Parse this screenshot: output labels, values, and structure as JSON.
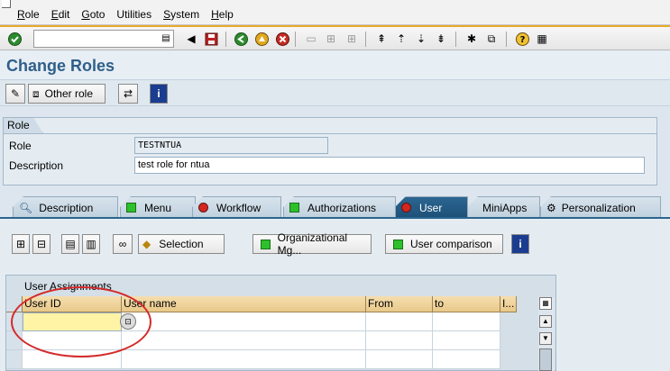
{
  "menu": {
    "items": [
      {
        "label": "Role",
        "mn": "R",
        "rest": "ole"
      },
      {
        "label": "Edit",
        "mn": "E",
        "rest": "dit"
      },
      {
        "label": "Goto",
        "mn": "G",
        "rest": "oto"
      },
      {
        "label": "Utilities",
        "mn": "",
        "rest": "Utilities"
      },
      {
        "label": "System",
        "mn": "S",
        "rest": "ystem"
      },
      {
        "label": "Help",
        "mn": "H",
        "rest": "elp"
      }
    ]
  },
  "toolbar": {
    "command_value": ""
  },
  "title": "Change Roles",
  "app_toolbar": {
    "other_role_label": "Other role"
  },
  "role_group": {
    "title": "Role",
    "role_label": "Role",
    "role_value": "TESTNTUA",
    "description_label": "Description",
    "description_value": "test role for ntua"
  },
  "tabs": [
    {
      "label": "Description"
    },
    {
      "label": "Menu"
    },
    {
      "label": "Workflow"
    },
    {
      "label": "Authorizations"
    },
    {
      "label": "User"
    },
    {
      "label": "MiniApps"
    },
    {
      "label": "Personalization"
    }
  ],
  "panel": {
    "selection_label": "Selection",
    "org_mgmt_label": "Organizational Mg...",
    "user_comparison_label": "User comparison"
  },
  "table": {
    "caption": "User Assignments",
    "columns": [
      "User ID",
      "User name",
      "From",
      "to",
      "I..."
    ],
    "help_glyph": "⊡"
  },
  "colors": {
    "accent": "#e8a92a",
    "title": "#2e5f8a",
    "active_tab": "#2b6590",
    "highlight_ring": "#d42a2a"
  }
}
